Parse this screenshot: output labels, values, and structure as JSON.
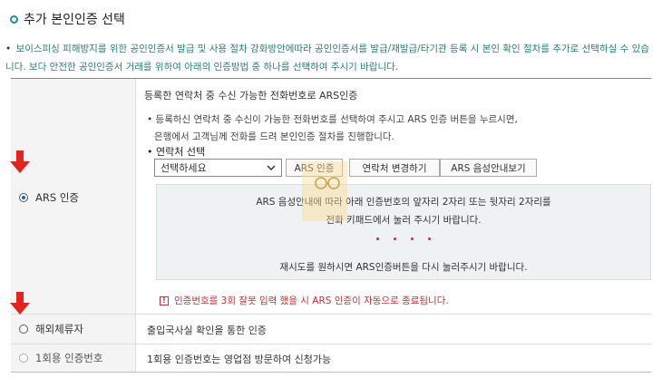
{
  "header": {
    "title": "추가 본인인증 선택"
  },
  "notice": {
    "bullet": "•",
    "text": "보이스피싱 피해방지를 위한 공인인증서 발급 및 사용 절차 강화방안에따라 공인인증서를 발급/재발급/타기관 등록 시 본인 확인 절차를 추가로 선택하실 수 있습니다. 보다 안전한 공인인증서 거래를 위하여 아래의 인증방법 중 하나를 선택하여 주시기 바랍니다."
  },
  "options": {
    "ars": {
      "label": "ARS 인증",
      "selected": true,
      "heading": "등록한 연락처 중 수신 가능한 전화번호로 ARS인증",
      "desc_line1": "• 등록하신 연락처 중 수신이 가능한 전화번호를 선택하여 주시고 ARS 인증 버튼을 누르시면,",
      "desc_line2": "은행에서 고객님께 전화를 드려 본인인증 절차를 진행합니다.",
      "contact_label": "• 연락처 선택",
      "select_value": "선택하세요",
      "buttons": {
        "ars_auth": "ARS 인증",
        "change_contact": "연락처 변경하기",
        "voice_guide": "ARS 음성안내보기"
      },
      "guide": {
        "line1": "ARS 음성안내에 따라 아래 인증번호의 앞자리 2자리 또는 뒷자리 2자리를",
        "line2": "전화 키패드에서 눌러 주시기 바랍니다.",
        "line3": "재시도를 원하시면 ARS인증버튼을 다시 눌러주시기 바랍니다."
      },
      "warning_icon": "!",
      "warning": "인증번호를 3회 잘못 입력 했을 시 ARS 인증이 자동으로 종료됩니다."
    },
    "overseas": {
      "label": "해외체류자",
      "selected": false,
      "desc": "출입국사실 확인을 통한 인증"
    },
    "onetime": {
      "label": "1회용 인증번호",
      "selected": false,
      "disabled": true,
      "desc": "1회용 인증번호는 영업점 방문하여 신청가능"
    }
  },
  "colors": {
    "accent_teal": "#1a8f9c",
    "notice_text": "#2a7f76",
    "warning_red": "#c2303a",
    "arrow_red": "#e0251b"
  },
  "icons": {
    "arrow": "red-down-arrow-icon",
    "select_caret": "chevron-down-icon",
    "warning": "warning-icon"
  }
}
